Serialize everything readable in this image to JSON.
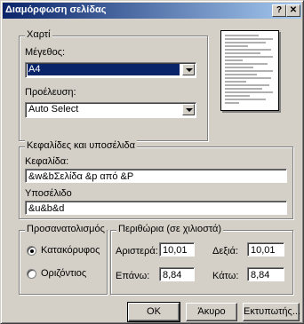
{
  "window": {
    "title": "Διαμόρφωση σελίδας",
    "help_label": "?",
    "close_label": "✕"
  },
  "paper": {
    "group_label": "Χαρτί",
    "size_label": "Μέγεθος:",
    "size_value": "A4",
    "source_label": "Προέλευση:",
    "source_value": "Auto Select"
  },
  "headers": {
    "group_label": "Κεφαλίδες και υποσέλιδα",
    "header_label": "Κεφαλίδα:",
    "header_value": "&w&bΣελίδα &p από &P",
    "footer_label": "Υποσέλιδο",
    "footer_value": "&u&b&d"
  },
  "orientation": {
    "group_label": "Προσανατολισμός",
    "portrait_label": "Κατακόρυφος",
    "landscape_label": "Οριζόντιος",
    "selected": "portrait"
  },
  "margins": {
    "group_label": "Περιθώρια (σε χιλιοστά)",
    "left_label": "Αριστερά:",
    "left_value": "10,01",
    "right_label": "Δεξιά:",
    "right_value": "10,01",
    "top_label": "Επάνω:",
    "top_value": "8,84",
    "bottom_label": "Κάτω:",
    "bottom_value": "8,84"
  },
  "buttons": {
    "ok": "OK",
    "cancel": "Άκυρο",
    "printer": "Εκτυπωτής..."
  }
}
